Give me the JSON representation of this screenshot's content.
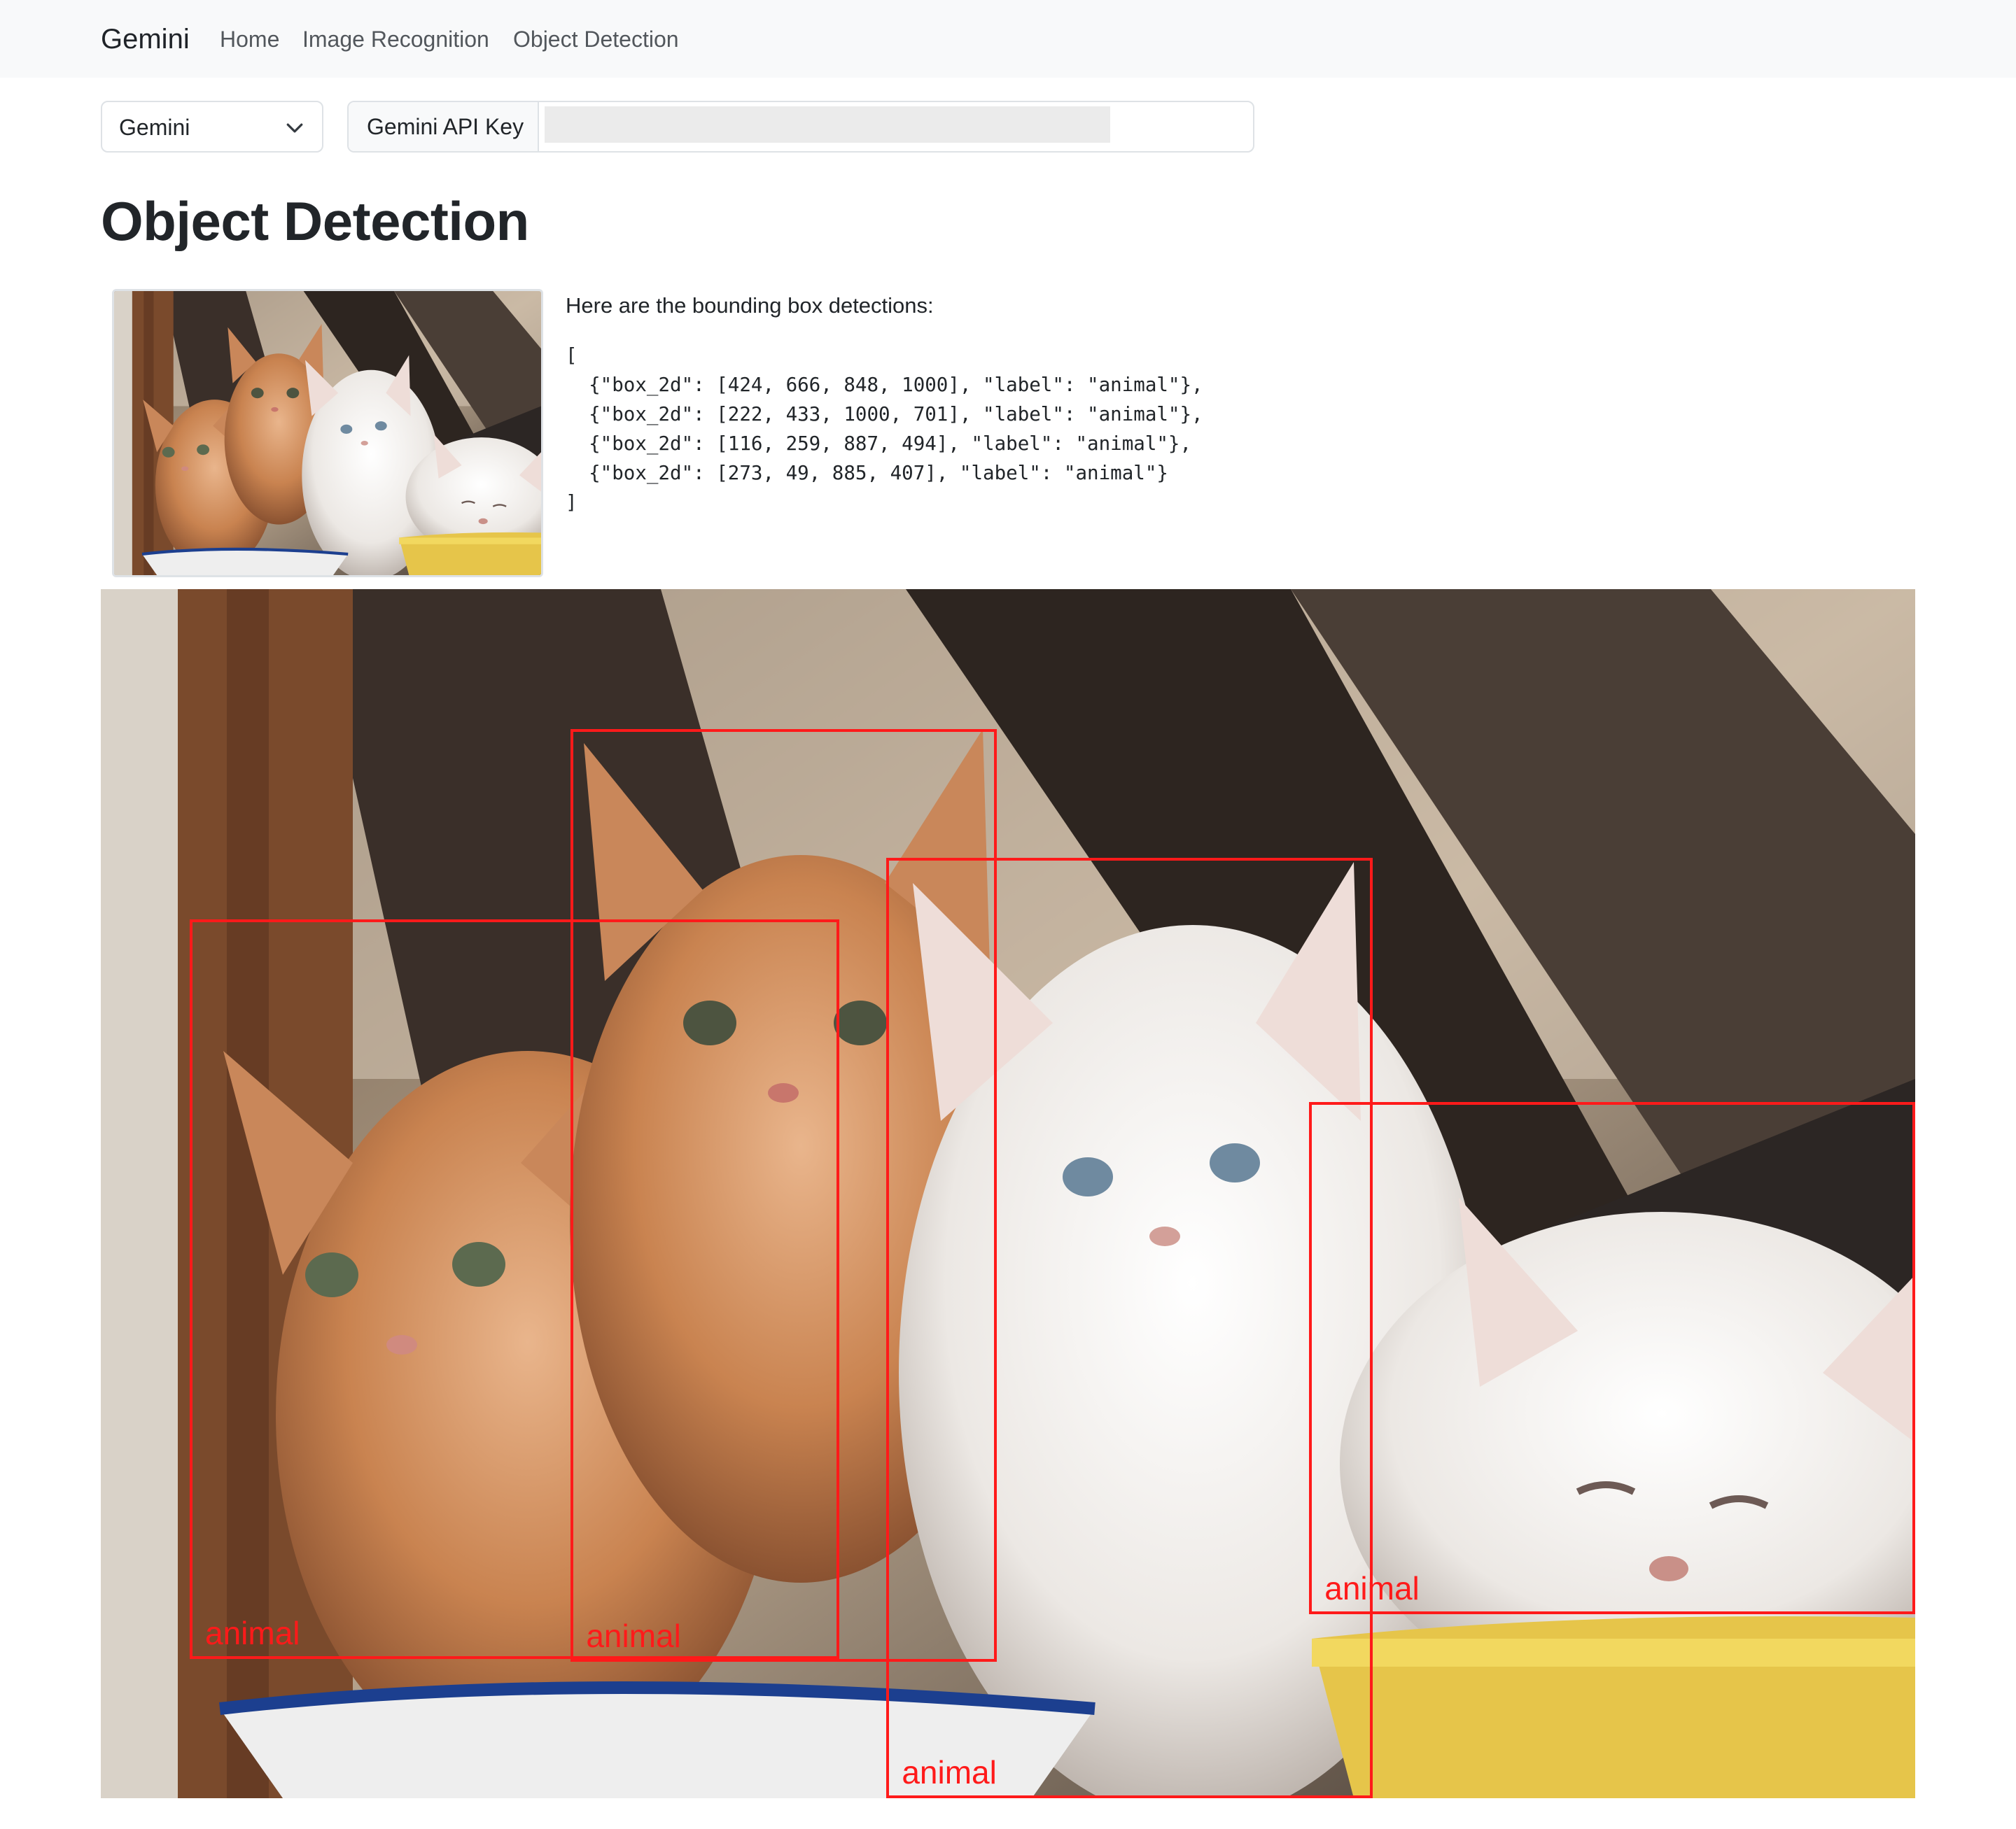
{
  "navbar": {
    "brand": "Gemini",
    "links": [
      "Home",
      "Image Recognition",
      "Object Detection"
    ]
  },
  "model_select": {
    "value": "Gemini",
    "icon": "chevron-down-icon"
  },
  "api_key": {
    "label": "Gemini API Key",
    "value": ""
  },
  "page_title": "Object Detection",
  "result": {
    "intro": "Here are the bounding box detections:",
    "json_text": "[\n  {\"box_2d\": [424, 666, 848, 1000], \"label\": \"animal\"},\n  {\"box_2d\": [222, 433, 1000, 701], \"label\": \"animal\"},\n  {\"box_2d\": [116, 259, 887, 494], \"label\": \"animal\"},\n  {\"box_2d\": [273, 49, 885, 407], \"label\": \"animal\"}\n]"
  },
  "detections": [
    {
      "box_2d": [
        424,
        666,
        848,
        1000
      ],
      "label": "animal"
    },
    {
      "box_2d": [
        222,
        433,
        1000,
        701
      ],
      "label": "animal"
    },
    {
      "box_2d": [
        116,
        259,
        887,
        494
      ],
      "label": "animal"
    },
    {
      "box_2d": [
        273,
        49,
        885,
        407
      ],
      "label": "animal"
    }
  ],
  "colors": {
    "box": "#ff1a1a",
    "navbar_bg": "#f8f9fa",
    "text": "#212529"
  }
}
